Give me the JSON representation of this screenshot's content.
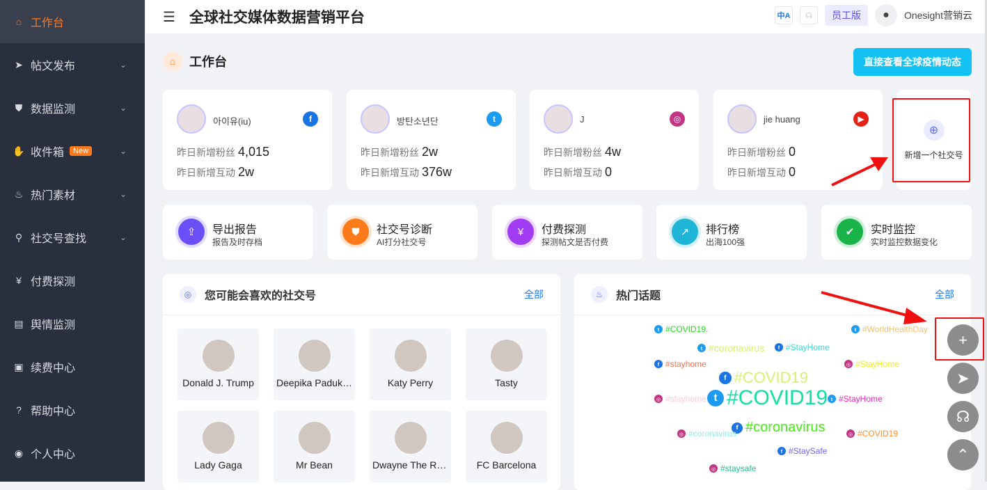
{
  "sidebar": {
    "items": [
      {
        "label": "工作台",
        "icon": "home-icon",
        "active": true
      },
      {
        "label": "帖文发布",
        "icon": "send-icon",
        "chevron": true
      },
      {
        "label": "数据监测",
        "icon": "shield-icon",
        "chevron": true
      },
      {
        "label": "收件箱",
        "icon": "thumb-icon",
        "chevron": true,
        "badge": "New"
      },
      {
        "label": "热门素材",
        "icon": "fire-icon",
        "chevron": true
      },
      {
        "label": "社交号查找",
        "icon": "user-search-icon",
        "chevron": true
      },
      {
        "label": "付费探测",
        "icon": "money-icon"
      },
      {
        "label": "舆情监测",
        "icon": "chart-icon"
      },
      {
        "label": "续费中心",
        "icon": "renew-icon"
      },
      {
        "label": "帮助中心",
        "icon": "help-icon"
      },
      {
        "label": "个人中心",
        "icon": "user-icon"
      }
    ]
  },
  "header": {
    "title": "全球社交媒体数据营销平台",
    "edition": "员工版",
    "user": "Onesight营销云",
    "lang_icon": "中A"
  },
  "page": {
    "title": "工作台",
    "cta": "直接查看全球疫情动态"
  },
  "accounts": [
    {
      "name": "아이유(iu)",
      "platform": "facebook",
      "fans_label": "昨日新增粉丝",
      "fans": "4,015",
      "inter_label": "昨日新增互动",
      "inter": "2w"
    },
    {
      "name": "방탄소년단",
      "platform": "twitter",
      "fans_label": "昨日新增粉丝",
      "fans": "2w",
      "inter_label": "昨日新增互动",
      "inter": "376w"
    },
    {
      "name": "J",
      "platform": "instagram",
      "fans_label": "昨日新增粉丝",
      "fans": "4w",
      "inter_label": "昨日新增互动",
      "inter": "0"
    },
    {
      "name": "jie huang",
      "platform": "youtube",
      "fans_label": "昨日新增粉丝",
      "fans": "0",
      "inter_label": "昨日新增互动",
      "inter": "0"
    }
  ],
  "add_account": "新增一个社交号",
  "features": [
    {
      "title": "导出报告",
      "sub": "报告及时存档",
      "color": "#6b4ef5",
      "icon": "upload-icon"
    },
    {
      "title": "社交号诊断",
      "sub": "AI打分社交号",
      "color": "#ff7a1a",
      "icon": "shield-icon"
    },
    {
      "title": "付费探测",
      "sub": "探测帖文是否付费",
      "color": "#a13cf2",
      "icon": "yen-icon"
    },
    {
      "title": "排行榜",
      "sub": "出海100强",
      "color": "#1fb5d6",
      "icon": "trend-icon"
    },
    {
      "title": "实时监控",
      "sub": "实时监控数据变化",
      "color": "#19b34a",
      "icon": "shield-check-icon"
    }
  ],
  "suggest": {
    "title": "您可能会喜欢的社交号",
    "all": "全部",
    "items": [
      "Donald J. Trump",
      "Deepika Padukone",
      "Katy Perry",
      "Tasty",
      "Lady Gaga",
      "Mr Bean",
      "Dwayne The Rock Johnson",
      "FC Barcelona"
    ]
  },
  "topics": {
    "title": "热门话题",
    "all": "全部",
    "tags": [
      {
        "text": "#COVID19.",
        "platform": "twitter",
        "color": "#22dd22",
        "size": 12
      },
      {
        "text": "#WorldHealthDay",
        "platform": "twitter",
        "color": "#f0c070",
        "size": 12
      },
      {
        "text": "#coronavirus",
        "platform": "twitter",
        "color": "#d8ee70",
        "size": 14
      },
      {
        "text": "#StayHome",
        "platform": "facebook",
        "color": "#33dddd",
        "size": 12
      },
      {
        "text": "#stayhome",
        "platform": "facebook",
        "color": "#f07050",
        "size": 12
      },
      {
        "text": "#StayHome",
        "platform": "instagram",
        "color": "#eeee20",
        "size": 12
      },
      {
        "text": "#COVID19",
        "platform": "facebook",
        "color": "#d8f070",
        "size": 22
      },
      {
        "text": "#stayhome",
        "platform": "instagram",
        "color": "#ffc8e0",
        "size": 12
      },
      {
        "text": "#COVID19",
        "platform": "twitter",
        "color": "#10e0a0",
        "size": 30
      },
      {
        "text": "#StayHome",
        "platform": "twitter",
        "color": "#ff20c0",
        "size": 12
      },
      {
        "text": "#coronavirus",
        "platform": "facebook",
        "color": "#44ee10",
        "size": 20
      },
      {
        "text": "#coronavirus",
        "platform": "instagram",
        "color": "#90eedd",
        "size": 12
      },
      {
        "text": "#COVID19",
        "platform": "instagram",
        "color": "#ff9030",
        "size": 12
      },
      {
        "text": "#StaySafe",
        "platform": "facebook",
        "color": "#7060ff",
        "size": 12
      },
      {
        "text": "#staysafe",
        "platform": "instagram",
        "color": "#20c090",
        "size": 12
      }
    ]
  },
  "fabs": [
    "plus-icon",
    "send-icon",
    "headset-icon",
    "chevron-up-icon"
  ]
}
